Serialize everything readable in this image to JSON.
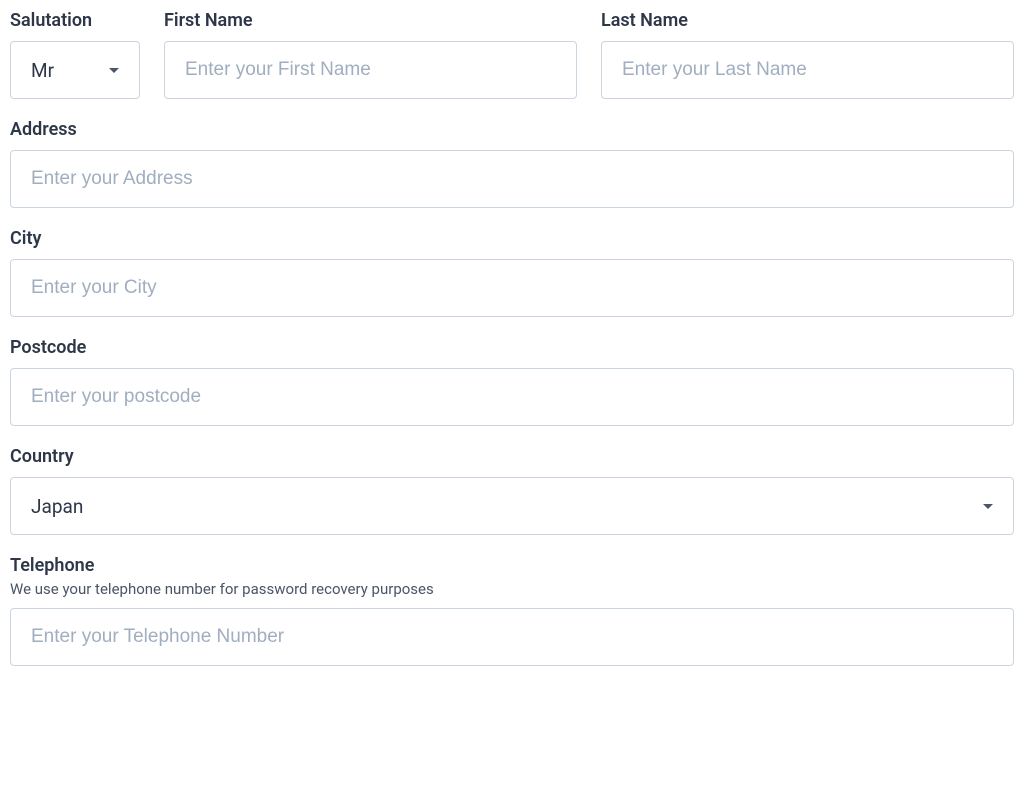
{
  "salutation": {
    "label": "Salutation",
    "value": "Mr"
  },
  "firstName": {
    "label": "First Name",
    "placeholder": "Enter your First Name",
    "value": ""
  },
  "lastName": {
    "label": "Last Name",
    "placeholder": "Enter your Last Name",
    "value": ""
  },
  "address": {
    "label": "Address",
    "placeholder": "Enter your Address",
    "value": ""
  },
  "city": {
    "label": "City",
    "placeholder": "Enter your City",
    "value": ""
  },
  "postcode": {
    "label": "Postcode",
    "placeholder": "Enter your postcode",
    "value": ""
  },
  "country": {
    "label": "Country",
    "value": "Japan"
  },
  "telephone": {
    "label": "Telephone",
    "helper": "We use your telephone number for password recovery purposes",
    "placeholder": "Enter your Telephone Number",
    "value": ""
  }
}
